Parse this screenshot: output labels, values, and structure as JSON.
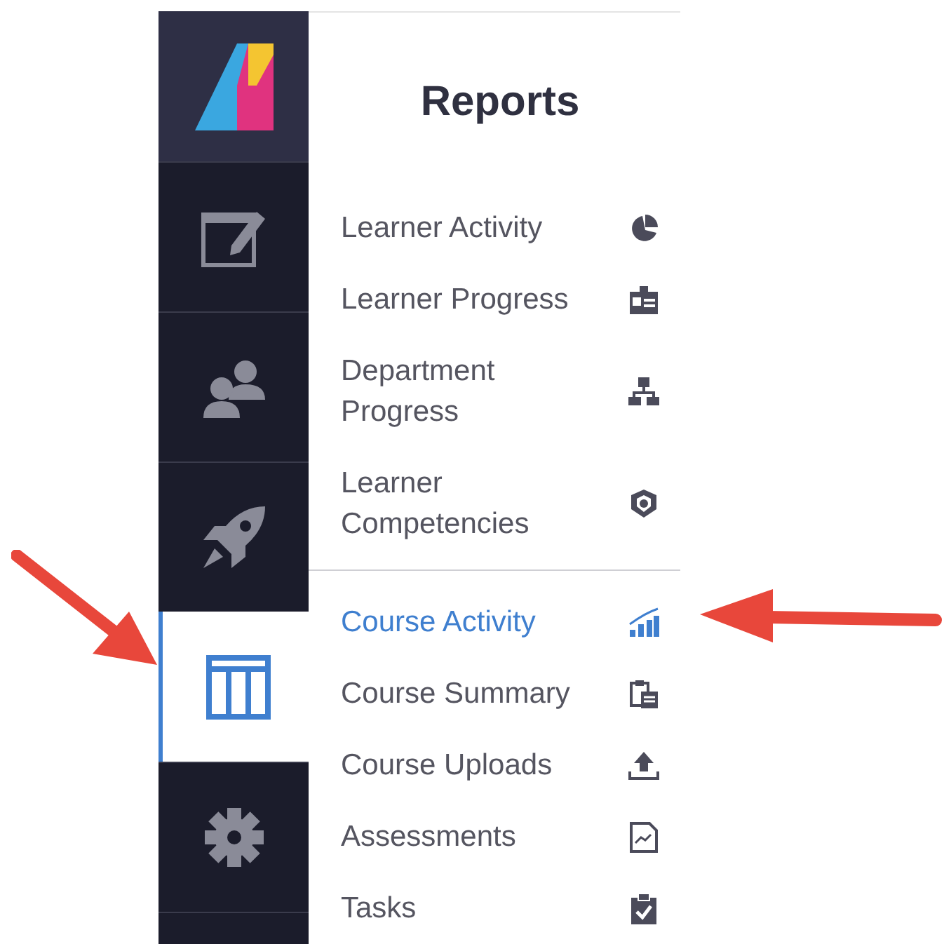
{
  "sidebar": {
    "items": [
      {
        "kind": "logo",
        "selected": false
      },
      {
        "kind": "editor",
        "selected": false
      },
      {
        "kind": "users",
        "selected": false
      },
      {
        "kind": "rocket",
        "selected": false
      },
      {
        "kind": "table",
        "selected": true
      },
      {
        "kind": "gear",
        "selected": false
      }
    ]
  },
  "panel": {
    "title": "Reports",
    "items": [
      {
        "label": "Learner Activity",
        "kind": "pie",
        "selected": false,
        "separator": false
      },
      {
        "label": "Learner Progress",
        "kind": "badge",
        "selected": false,
        "separator": false
      },
      {
        "label": "Department Progress",
        "kind": "hierarchy",
        "selected": false,
        "separator": false
      },
      {
        "label": "Learner Competencies",
        "kind": "shield",
        "selected": false,
        "separator": false
      },
      {
        "label": "Course Activity",
        "kind": "bars",
        "selected": true,
        "separator": true
      },
      {
        "label": "Course Summary",
        "kind": "clipboard",
        "selected": false,
        "separator": false
      },
      {
        "label": "Course Uploads",
        "kind": "upload",
        "selected": false,
        "separator": false
      },
      {
        "label": "Assessments",
        "kind": "chart-doc",
        "selected": false,
        "separator": false
      },
      {
        "label": "Tasks",
        "kind": "task",
        "selected": false,
        "separator": false
      }
    ]
  }
}
